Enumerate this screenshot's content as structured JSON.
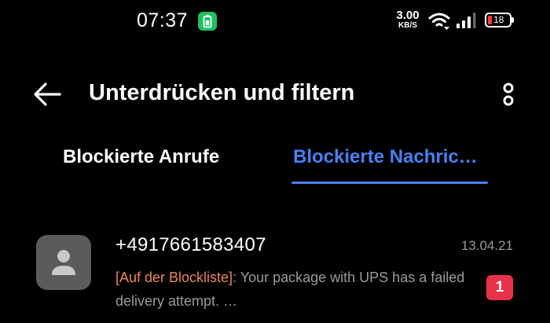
{
  "status_bar": {
    "time": "07:37",
    "net_speed_value": "3.00",
    "net_speed_unit": "KB/S",
    "battery_level": "18",
    "icons": [
      "battery-saver-icon",
      "wifi-icon",
      "signal-icon",
      "battery-icon"
    ]
  },
  "header": {
    "title": "Unterdrücken und filtern",
    "icons": [
      "back-arrow-icon",
      "more-options-icon"
    ]
  },
  "tabs": [
    {
      "label": "Blockierte Anrufe",
      "active": false
    },
    {
      "label": "Blockierte Nachric…",
      "active": true
    }
  ],
  "messages": [
    {
      "sender": "+4917661583407",
      "date": "13.04.21",
      "tag": "[Auf der Blockliste]",
      "preview": ": Your package with UPS has a failed delivery attempt. …",
      "unread_count": "1",
      "avatar_icon": "person-icon"
    }
  ],
  "colors": {
    "background": "#000000",
    "accent": "#4a7ff0",
    "tag": "#e8855a",
    "badge": "#e8324a",
    "secondary_text": "#9a9a9a",
    "battery_low": "#ff3b3b",
    "battery_saver": "#1fbf62"
  }
}
